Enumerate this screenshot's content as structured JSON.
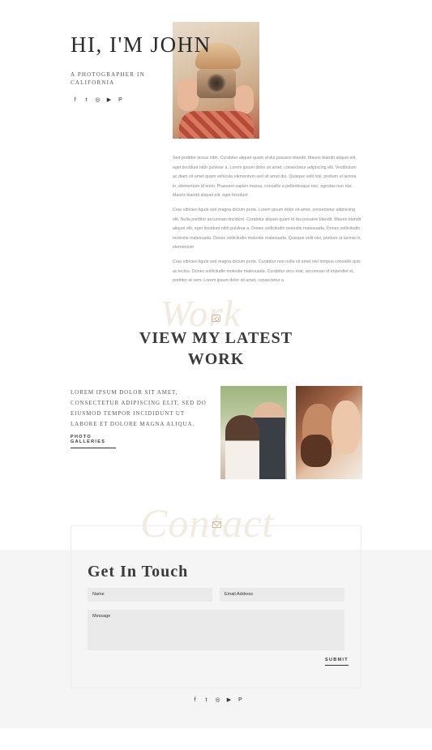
{
  "hero": {
    "title": "HI, I'M JOHN",
    "subtitle": "A PHOTOGRAPHER IN CALIFORNIA",
    "social_icons": [
      "facebook-icon",
      "twitter-icon",
      "instagram-icon",
      "youtube-icon",
      "pinterest-icon"
    ],
    "social_glyphs": [
      "f",
      "t",
      "◎",
      "▶",
      "P"
    ]
  },
  "about": {
    "paragraphs": [
      "Sed porttitor lectus nibh. Curabitur aliquet quam id dui posuere blandit. Mauris blandit aliquet elit, eget tincidunt nibh pulvinar a. Lorem ipsum dolor sit amet, consectetur adipiscing elit. Vestibulum ac diam sit amet quam vehicula elementum sed sit amet dui. Quisque velit nisi, pretium ut lacinia in, elementum id enim. Praesent sapien massa, convallis a pellentesque nec, egestas non nisi. Mauris blandit aliquet elit, eget tincidunt",
      "Cras ultricies ligula sed magna dictum porta. Lorem ipsum dolor sit amet, consectetur adipiscing elit. Nulla porttitor accumsan tincidunt. Curabitur aliquet quam id dui posuere blandit. Mauris blandit aliquet elit, eget tincidunt nibh pulvinar a. Donec sollicitudin molestie malesuada. Donec sollicitudin molestie malesuada. Donec sollicitudin molestie malesuada. Quisque velit nisi, pretium ut lacinia in, elementum",
      "Cras ultricies ligula sed magna dictum porta. Curabitur non nulla sit amet nisl tempus convallis quis ac lectus. Donec sollicitudin molestie malesuada. Curabitur arcu erat, accumsan id imperdiet et, porttitor at sem. Lorem ipsum dolor sit amet, consectetur a"
    ]
  },
  "work": {
    "script_word": "Work",
    "title": "VIEW MY LATEST WORK",
    "description": "LOREM IPSUM DOLOR SIT AMET, CONSECTETUR ADIPISCING ELIT, SED DO EIUSMOD TEMPOR INCIDIDUNT UT LABORE ET DOLORE MAGNA ALIQUA.",
    "link_label": "PHOTO GALLERIES"
  },
  "contact": {
    "script_word": "Contact",
    "title": "Get In Touch",
    "name_placeholder": "Name",
    "email_placeholder": "Email Address",
    "message_placeholder": "Message",
    "submit_label": "SUBMIT"
  },
  "footer": {
    "social_icons": [
      "facebook-icon",
      "twitter-icon",
      "instagram-icon",
      "youtube-icon",
      "pinterest-icon"
    ],
    "social_glyphs": [
      "f",
      "t",
      "◎",
      "▶",
      "P"
    ]
  },
  "colors": {
    "accent": "#d6b99a",
    "band": "#f5f5f5",
    "field": "#eaeaea"
  }
}
